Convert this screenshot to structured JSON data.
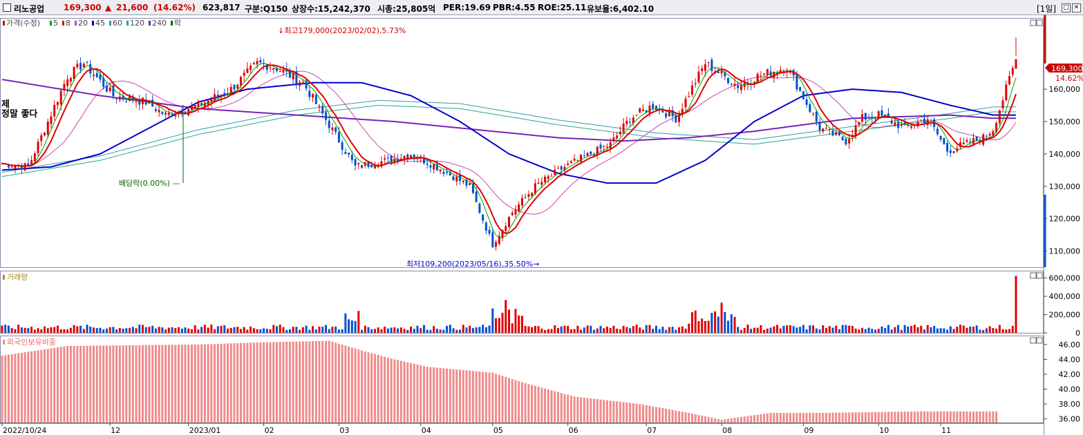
{
  "header": {
    "stock_name": "리노공업",
    "price": "169,300",
    "change_arrow": "▲",
    "change": "21,600",
    "change_pct": "(14.62%)",
    "volume": "623,817",
    "market": "구분:Q150",
    "shares": "상장수:15,242,370",
    "market_cap": "시총:25,805억",
    "per": "PER:19.69",
    "pbr": "PBR:4.55",
    "roe": "ROE:25.11",
    "float": "유보율:6,402.10",
    "period": "[1일]"
  },
  "price_panel": {
    "legend": [
      {
        "label": "가격(수정)",
        "color": "#d40000"
      },
      {
        "label": "5",
        "color": "#00a000"
      },
      {
        "label": "8",
        "color": "#dd0000"
      },
      {
        "label": "20",
        "color": "#cc44aa"
      },
      {
        "label": "45",
        "color": "#0000cc"
      },
      {
        "label": "60",
        "color": "#3399aa"
      },
      {
        "label": "120",
        "color": "#22aa88"
      },
      {
        "label": "240",
        "color": "#7722bb"
      },
      {
        "label": "락",
        "color": "#006600"
      }
    ],
    "annotations": {
      "high": "최고179,000(2023/02/02),5.73%",
      "low": "최저109,200(2023/05/16),35.50%",
      "dividend": "배당락(0.00%)",
      "memo_line1": "제",
      "memo_line2": "정말 좋다"
    },
    "current_tag": "169,300",
    "current_pct": "14.62%",
    "y_ticks": [
      "160,000",
      "150,000",
      "140,000",
      "130,000",
      "120,000",
      "110,000"
    ]
  },
  "volume_panel": {
    "legend": "거래량",
    "y_ticks": [
      "600,000",
      "400,000",
      "200,000",
      "0"
    ]
  },
  "foreign_panel": {
    "legend": "외국인보유비중",
    "y_ticks": [
      "46.00",
      "44.00",
      "42.00",
      "40.00",
      "38.00",
      "36.00"
    ]
  },
  "x_ticks": [
    "2022/10/24",
    "12",
    "2023/01",
    "02",
    "03",
    "04",
    "05",
    "06",
    "07",
    "08",
    "09",
    "10",
    "11"
  ],
  "chart_data": {
    "type": "line",
    "title": "리노공업",
    "x_unit": "trading day",
    "price_axis": {
      "ylim": [
        105000,
        182000
      ]
    },
    "price_close_anchors": {
      "x": [
        0,
        8,
        20,
        25,
        34,
        44,
        50,
        60,
        70,
        78,
        83,
        92,
        108,
        118,
        125,
        133,
        143,
        150,
        156,
        163,
        172,
        180,
        186,
        192,
        199,
        206,
        215,
        225,
        231,
        240,
        250,
        258,
        263,
        268,
        276,
        283,
        289,
        300,
        303,
        310
      ],
      "values": [
        137000,
        136000,
        164000,
        168000,
        158000,
        156000,
        152000,
        155000,
        160000,
        168000,
        167000,
        162000,
        136000,
        138000,
        140000,
        136000,
        130000,
        112000,
        122000,
        130000,
        136000,
        140000,
        143000,
        151000,
        155000,
        151000,
        168000,
        161000,
        164000,
        167000,
        148000,
        144000,
        151000,
        152000,
        148000,
        151000,
        141000,
        145000,
        147700,
        169300
      ]
    },
    "ma_labels": [
      "5",
      "8",
      "20",
      "45",
      "60",
      "120",
      "240"
    ],
    "ma45_anchors": {
      "x": [
        0,
        15,
        30,
        45,
        60,
        75,
        95,
        110,
        125,
        140,
        155,
        170,
        185,
        200,
        215,
        230,
        245,
        260,
        275,
        290,
        303
      ],
      "values": [
        135000,
        136000,
        140000,
        148000,
        156000,
        160000,
        162000,
        162000,
        158000,
        150000,
        140000,
        134000,
        131000,
        131000,
        138000,
        150000,
        158000,
        160000,
        159000,
        155000,
        152000
      ]
    },
    "ma120_anchors": {
      "x": [
        0,
        30,
        60,
        90,
        115,
        140,
        170,
        200,
        230,
        260,
        290,
        303
      ],
      "values": [
        133000,
        138000,
        146000,
        152000,
        155000,
        154000,
        149000,
        145000,
        143000,
        147000,
        151000,
        153000
      ]
    },
    "ma240_anchors": {
      "x": [
        0,
        30,
        60,
        90,
        120,
        150,
        170,
        190,
        210,
        230,
        260,
        290,
        303
      ],
      "values": [
        163000,
        158000,
        154000,
        152000,
        150000,
        147000,
        145000,
        144000,
        145000,
        147000,
        151000,
        152000,
        151000
      ]
    },
    "volume": {
      "ylim": [
        0,
        650000
      ],
      "peak_value": 623817
    },
    "foreign_ownership_pct": {
      "ylim": [
        35.5,
        47.2
      ],
      "x": [
        0,
        20,
        40,
        60,
        80,
        100,
        110,
        120,
        130,
        150,
        160,
        175,
        195,
        210,
        220,
        235,
        250,
        265,
        280,
        303
      ],
      "values": [
        44.5,
        45.8,
        45.9,
        46.0,
        46.3,
        46.5,
        45.2,
        44.0,
        43.0,
        42.2,
        40.8,
        39.0,
        38.0,
        36.8,
        35.9,
        36.8,
        36.8,
        36.9,
        37.0,
        37.0
      ]
    }
  }
}
